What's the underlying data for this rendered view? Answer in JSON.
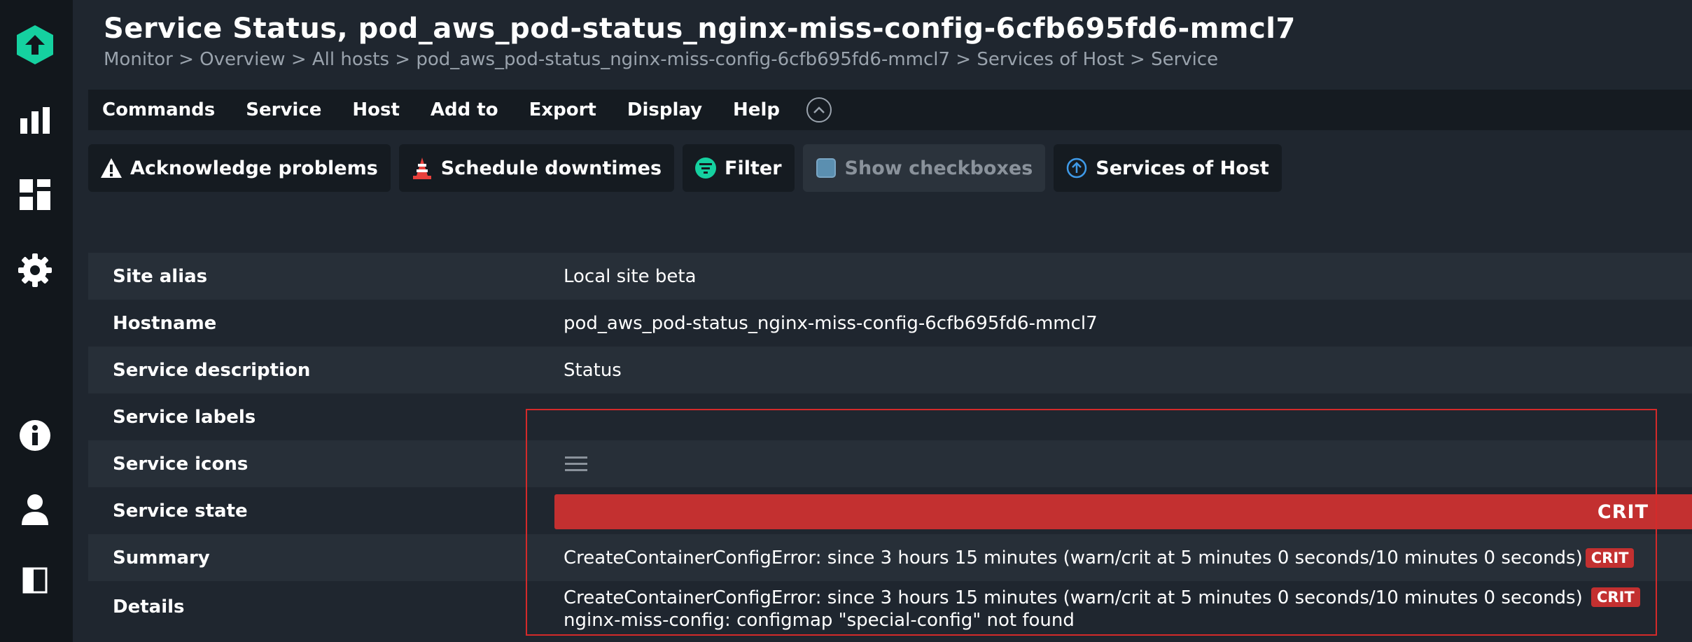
{
  "page": {
    "title": "Service Status, pod_aws_pod-status_nginx-miss-config-6cfb695fd6-mmcl7",
    "breadcrumb": "Monitor > Overview > All hosts > pod_aws_pod-status_nginx-miss-config-6cfb695fd6-mmcl7 > Services of Host > Service"
  },
  "sidebar": {
    "icons": [
      "checkmk-logo-icon",
      "monitor-chart-icon",
      "dashboard-grid-icon",
      "setup-gear-icon",
      "help-info-icon",
      "user-icon",
      "sidebar-toggle-icon"
    ]
  },
  "menu": {
    "items": [
      "Commands",
      "Service",
      "Host",
      "Add to",
      "Export",
      "Display",
      "Help"
    ]
  },
  "toolbar": {
    "acknowledge": "Acknowledge problems",
    "downtimes": "Schedule downtimes",
    "filter": "Filter",
    "checkboxes": "Show checkboxes",
    "services_of_host": "Services of Host"
  },
  "details": {
    "site_alias_label": "Site alias",
    "site_alias_value": "Local site beta",
    "hostname_label": "Hostname",
    "hostname_value": "pod_aws_pod-status_nginx-miss-config-6cfb695fd6-mmcl7",
    "service_description_label": "Service description",
    "service_description_value": "Status",
    "service_labels_label": "Service labels",
    "service_icons_label": "Service icons",
    "service_state_label": "Service state",
    "service_state_value": "CRIT",
    "summary_label": "Summary",
    "summary_value": "CreateContainerConfigError: since 3 hours 15 minutes (warn/crit at 5 minutes 0 seconds/10 minutes 0 seconds)",
    "summary_badge": "CRIT",
    "details_label": "Details",
    "details_line1": "CreateContainerConfigError: since 3 hours 15 minutes (warn/crit at 5 minutes 0 seconds/10 minutes 0 seconds)",
    "details_badge": "CRIT",
    "details_line2": "nginx-miss-config: configmap \"special-config\" not found"
  },
  "colors": {
    "crit": "#c33030",
    "accent": "#15d1a0",
    "highlight_border": "#d42a2a"
  }
}
